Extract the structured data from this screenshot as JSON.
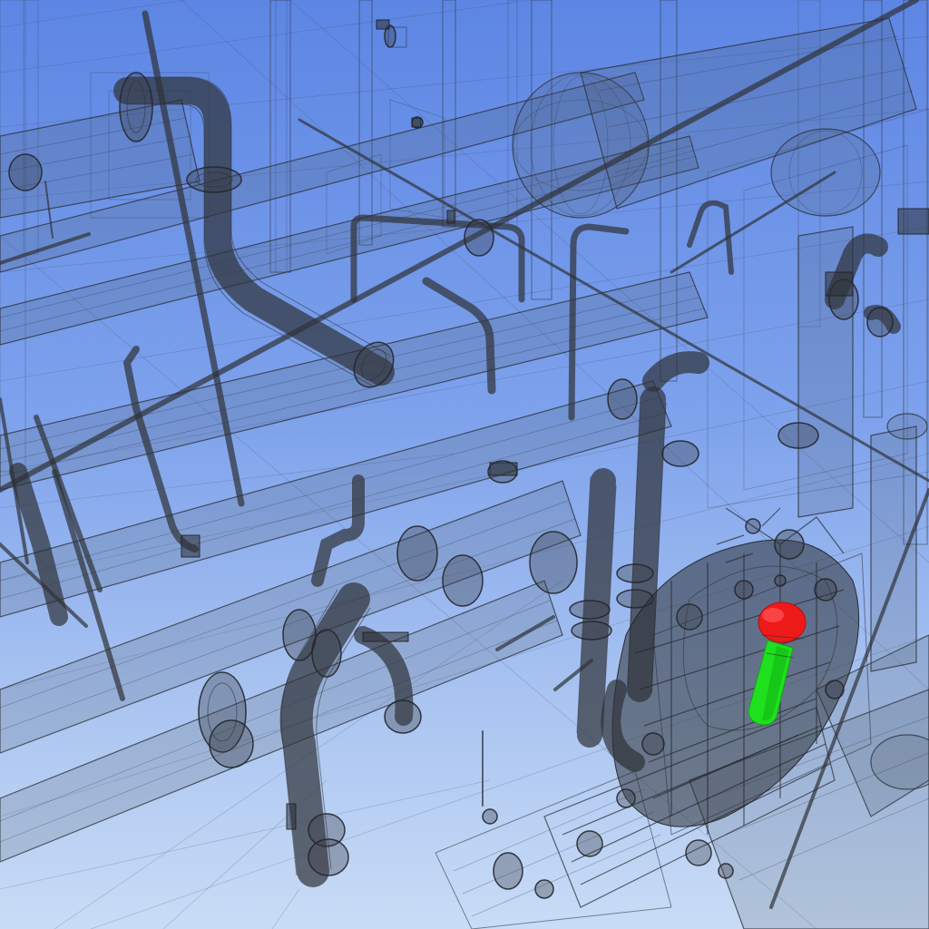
{
  "viewer": {
    "background_top": "#5d86e4",
    "background_bottom": "#c9dcf6",
    "wire_color": "#2c2f36",
    "render_mode": "wireframe"
  },
  "highlight": {
    "cap_color": "#ee1a1a",
    "stem_color": "#1fe01f"
  }
}
